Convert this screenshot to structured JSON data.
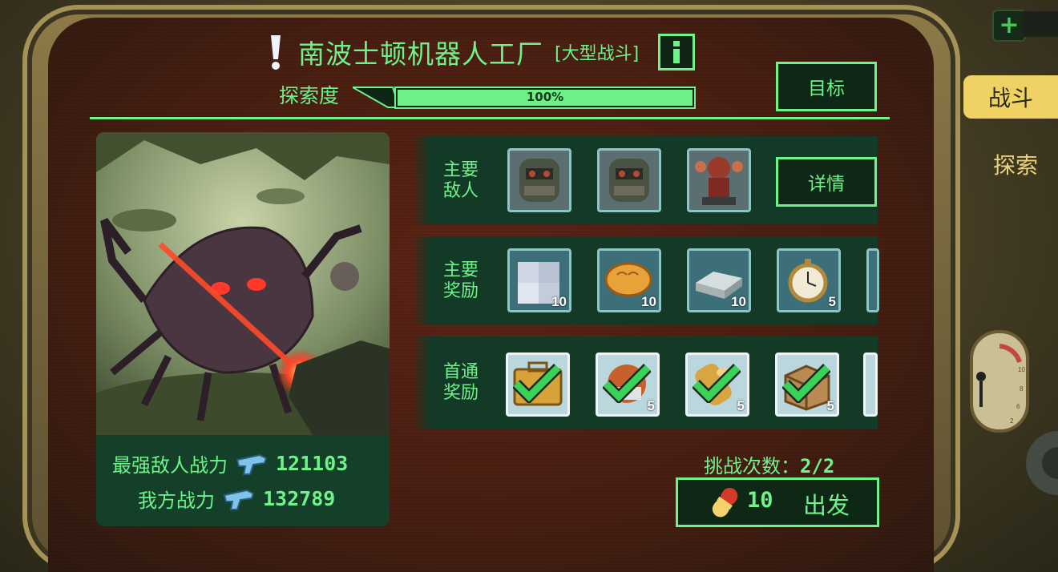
{
  "title": "南波士顿机器人工厂",
  "tag": "[大型战斗]",
  "explore": {
    "label": "探索度",
    "percent_text": "100%",
    "progress": 1.0
  },
  "buttons": {
    "goal": "目标",
    "details": "详情"
  },
  "side_tabs": {
    "battle": "战斗",
    "explore": "探索"
  },
  "sections": {
    "enemies_label": "主要\n敌人",
    "rewards_label": "主要\n奖励",
    "first_clear_label": "首通\n奖励"
  },
  "enemies": [
    {
      "icon": "power-armor-robot-icon"
    },
    {
      "icon": "power-armor-robot-icon"
    },
    {
      "icon": "red-sentry-robot-icon"
    }
  ],
  "rewards": [
    {
      "icon": "steel-cubes-icon",
      "count": "10"
    },
    {
      "icon": "bread-loaf-icon",
      "count": "10"
    },
    {
      "icon": "metal-bars-icon",
      "count": "10"
    },
    {
      "icon": "pocket-watch-icon",
      "count": "5"
    }
  ],
  "first_clear": [
    {
      "icon": "lunchbox-icon",
      "count": ""
    },
    {
      "icon": "helmet-icon",
      "count": "5"
    },
    {
      "icon": "wood-log-icon",
      "count": "5"
    },
    {
      "icon": "cardboard-box-icon",
      "count": "5"
    }
  ],
  "stats": {
    "strongest_enemy_label": "最强敌人战力",
    "strongest_enemy_value": "121103",
    "our_power_label": "我方战力",
    "our_power_value": "132789"
  },
  "challenge": {
    "label": "挑战次数：",
    "value": "2/2"
  },
  "depart": {
    "cost": "10",
    "label": "出发"
  },
  "colors": {
    "ui_green": "#6ff28a",
    "screen_red": "#5e2416",
    "tab_yellow": "#f3d56b"
  }
}
